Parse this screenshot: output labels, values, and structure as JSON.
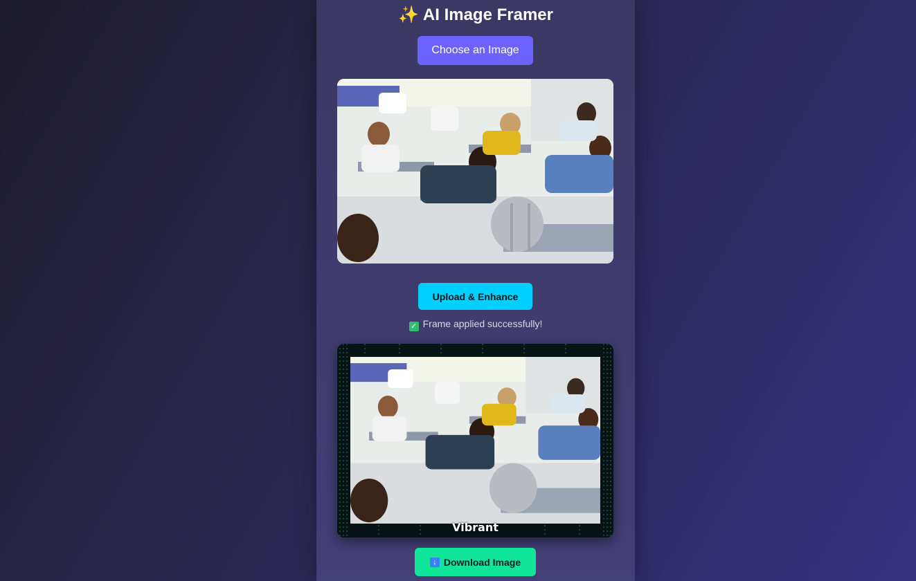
{
  "header": {
    "title": "AI Image Framer",
    "icon": "sparkles-icon"
  },
  "actions": {
    "choose_label": "Choose an Image",
    "enhance_label": "Upload & Enhance",
    "download_label": "Download Image"
  },
  "status": {
    "text": "Frame applied successfully!",
    "icon": "check-box-icon"
  },
  "frame": {
    "caption": "Vibrant",
    "style": "matrix-rain"
  },
  "colors": {
    "choose": "#6c63ff",
    "enhance": "#00cfff",
    "download": "#11e59a",
    "success": "#2fbf71"
  }
}
